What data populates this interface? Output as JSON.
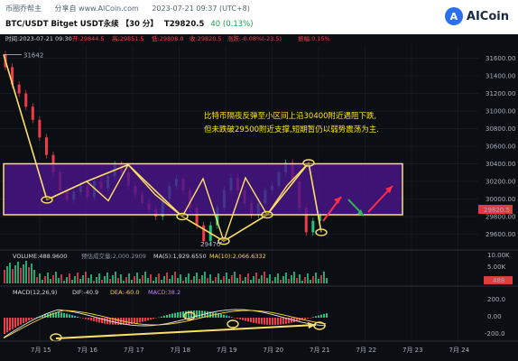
{
  "header": {
    "nav_left": "币圈乔帮主",
    "nav_share": "分享自 www.AICoin.com",
    "nav_time": "2023-07-21 09:37 (UTC+8)",
    "title": "BTC/USDT Bitget USDT永续 【30 分】",
    "price": "T29820.5",
    "change": "40 (0.13%)",
    "logo_mark": "A",
    "logo_text": "AICoin"
  },
  "ohlc": {
    "time": "时间:2023-07-21 09:30",
    "open": "开:29844.5",
    "high": "高:29851.5",
    "low": "低:29808.0",
    "close": "收:29820.5",
    "change": "涨跌:-0.08%(-23.5)",
    "amplitude": "振幅:0.15%"
  },
  "volume_info": {
    "volume": "VOLUME:488.9600",
    "forecast": "预估成交量:2,000.2909",
    "ma5": "MA(5):1,929.6550",
    "ma10": "MA(10):2,066.6332"
  },
  "macd_info": {
    "name": "MACD(12,26,9)",
    "dif": "DIF:-40.9",
    "dea": "DEA:-60.0",
    "macd": "MACD:38.2"
  },
  "annotation": {
    "line1": "比特币隔夜反弹至小区间上沿30400附近遇阻下跌,",
    "line2": "但未跌破29500附近支撑,短期暂仍以弱势震荡为主."
  },
  "colors": {
    "box_fill": "#4a148c",
    "box_stroke": "#ffe066",
    "up": "#26c281",
    "down": "#ef3b4b",
    "price_tag": "#e23b3b",
    "arrow_red": "#ff2d4a",
    "arrow_green": "#27c24c"
  },
  "chart_data": {
    "type": "line",
    "price_axis": {
      "ticks": [
        "31600.00",
        "31400.00",
        "31200.00",
        "31000.00",
        "30800.00",
        "30600.00",
        "30400.00",
        "30200.00",
        "30000.00",
        "29800.00",
        "29600.00"
      ],
      "ylim": [
        29450,
        31750
      ],
      "last_price_tag": "29820.5"
    },
    "volume_axis": {
      "ticks": [
        "10.00K",
        "5.00K"
      ],
      "last_tag": "488"
    },
    "macd_axis": {
      "ticks": [
        "200.0",
        "0.00",
        "-200.0"
      ]
    },
    "x_axis_labels": [
      "7月 15",
      "7月 16",
      "7月 17",
      "7月 18",
      "7月 19",
      "7月 20",
      "7月 21",
      "7月 22",
      "7月 23",
      "7月 24"
    ],
    "annotated_levels": {
      "high_label": "31642",
      "low_label": "29470"
    },
    "range_box": {
      "top": 30400,
      "bottom": 29820
    },
    "pattern_points": [
      {
        "x": "7月 14",
        "y": 31642
      },
      {
        "x": "7月 15",
        "y": 29990
      },
      {
        "x": "7月 16",
        "y": 30200
      },
      {
        "x": "7月 17",
        "y": 30390
      },
      {
        "x": "7月 18",
        "y": 29800
      },
      {
        "x": "7月 19",
        "y": 29520
      },
      {
        "x": "7月 20",
        "y": 29820
      },
      {
        "x": "7月 21",
        "y": 30410
      },
      {
        "x": "7月 21",
        "y": 29620
      }
    ]
  }
}
